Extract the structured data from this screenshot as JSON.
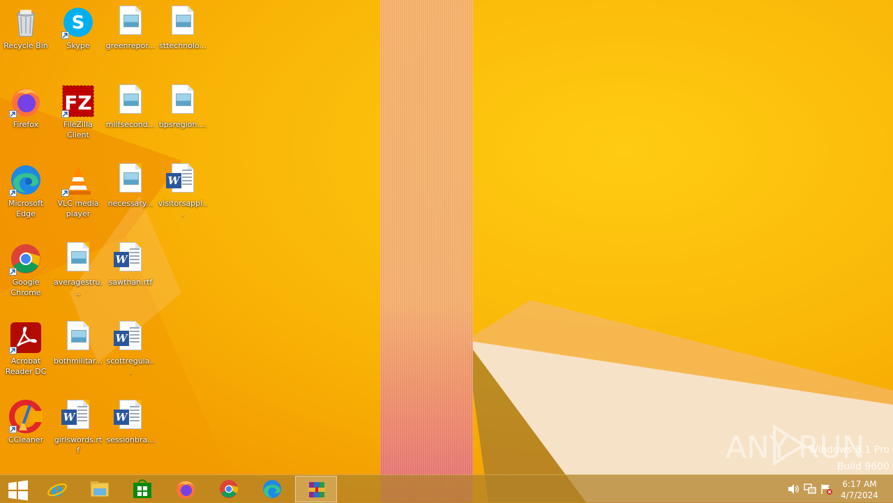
{
  "desktop": {
    "icons": [
      {
        "label": "Recycle Bin",
        "icon": "recycle-bin-icon"
      },
      {
        "label": "Skype",
        "icon": "skype-icon"
      },
      {
        "label": "greenrepor...",
        "icon": "image-file-icon"
      },
      {
        "label": "sttechnolo...",
        "icon": "image-file-icon"
      },
      {
        "label": "Firefox",
        "icon": "firefox-icon"
      },
      {
        "label": "FileZilla Client",
        "icon": "filezilla-icon"
      },
      {
        "label": "milfsecond...",
        "icon": "image-file-icon"
      },
      {
        "label": "tipsregion....",
        "icon": "image-file-icon"
      },
      {
        "label": "Microsoft Edge",
        "icon": "edge-icon"
      },
      {
        "label": "VLC media player",
        "icon": "vlc-icon"
      },
      {
        "label": "necessary...",
        "icon": "image-file-icon"
      },
      {
        "label": "visitorsappl...",
        "icon": "word-document-icon"
      },
      {
        "label": "Google Chrome",
        "icon": "chrome-icon"
      },
      {
        "label": "averagestru...",
        "icon": "image-file-icon"
      },
      {
        "label": "sawthan.rtf",
        "icon": "word-document-icon"
      },
      {
        "label": "Acrobat Reader DC",
        "icon": "acrobat-icon"
      },
      {
        "label": "bothmilitar...",
        "icon": "image-file-icon"
      },
      {
        "label": "scottregula...",
        "icon": "word-document-icon"
      },
      {
        "label": "CCleaner",
        "icon": "ccleaner-icon"
      },
      {
        "label": "girlswords.rtf",
        "icon": "word-document-icon"
      },
      {
        "label": "sessionbra...",
        "icon": "word-document-icon"
      }
    ]
  },
  "watermark": {
    "brand": "ANY RUN",
    "edition": "Windows 8.1 Pro",
    "build": "Build 9600"
  },
  "taskbar": {
    "buttons": [
      {
        "name": "start-button",
        "icon": "windows-logo-icon"
      },
      {
        "name": "internet-explorer",
        "icon": "internet-explorer-icon"
      },
      {
        "name": "file-explorer",
        "icon": "file-explorer-icon"
      },
      {
        "name": "windows-store",
        "icon": "store-icon"
      },
      {
        "name": "firefox",
        "icon": "firefox-icon"
      },
      {
        "name": "chrome",
        "icon": "chrome-icon"
      },
      {
        "name": "edge",
        "icon": "edge-icon"
      },
      {
        "name": "winrar",
        "icon": "winrar-icon",
        "active": true
      }
    ],
    "tray": {
      "icons": [
        "speaker-icon",
        "network-icon",
        "action-center-flag-icon"
      ],
      "time": "6:17 AM",
      "date": "4/7/2024"
    }
  },
  "colors": {
    "wallpaper": "#f6a800",
    "taskbar": "#b08128"
  }
}
